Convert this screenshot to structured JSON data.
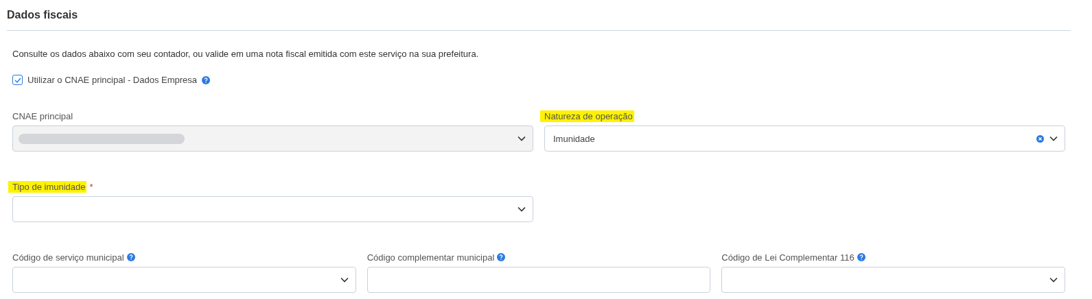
{
  "title": "Dados fiscais",
  "intro": "Consulte os dados abaixo com seu contador, ou valide em uma nota fiscal emitida com este serviço na sua prefeitura.",
  "use_main_cnae": {
    "label": "Utilizar o CNAE principal - Dados Empresa",
    "checked": true,
    "help": true
  },
  "rows": [
    {
      "fields": [
        {
          "kind": "select",
          "label": "CNAE principal",
          "highlighted": false,
          "disabled": true,
          "redacted": true
        },
        {
          "kind": "select",
          "label": "Natureza de operação",
          "highlighted": true,
          "disabled": false,
          "value": "Imunidade",
          "clearable": true
        }
      ]
    },
    {
      "fields": [
        {
          "kind": "select",
          "label": "Tipo de imunidade",
          "highlighted": true,
          "disabled": false,
          "required_mark": "*"
        }
      ]
    },
    {
      "fields": [
        {
          "kind": "select",
          "label": "Código de serviço municipal",
          "highlighted": false,
          "disabled": false,
          "help": true
        },
        {
          "kind": "text",
          "label": "Código complementar municipal",
          "highlighted": false,
          "disabled": false,
          "help": true
        },
        {
          "kind": "select",
          "label": "Código de Lei Complementar 116",
          "highlighted": false,
          "disabled": false,
          "help": true
        }
      ]
    }
  ]
}
